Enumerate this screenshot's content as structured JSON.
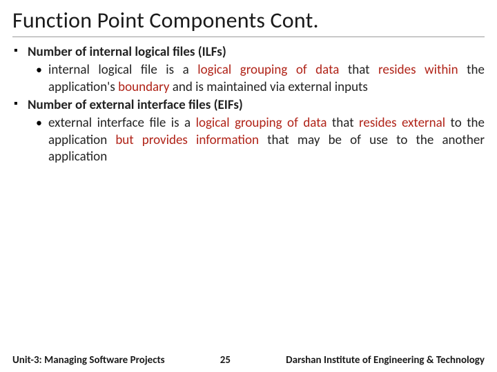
{
  "title": "Function Point Components Cont.",
  "bullets": {
    "ilf": {
      "heading": "Number of internal logical files (ILFs)",
      "sub_pre": "internal logical file is a ",
      "sub_hl1": "logical grouping of data",
      "sub_mid1": " that ",
      "sub_hl2": "resides within",
      "sub_mid2": " the application's ",
      "sub_hl3": "boundary",
      "sub_post": " and is maintained via external inputs"
    },
    "eif": {
      "heading": "Number of external interface files (EIFs)",
      "sub_pre": "external interface file is a ",
      "sub_hl1": "logical grouping of data",
      "sub_mid1": " that ",
      "sub_hl2": "resides external",
      "sub_mid2": " to the application ",
      "sub_hl3": "but provides information",
      "sub_post": " that may be of use to the another application"
    }
  },
  "footer": {
    "left": "Unit-3: Managing Software Projects",
    "page": "25",
    "right": "Darshan Institute of Engineering & Technology"
  }
}
